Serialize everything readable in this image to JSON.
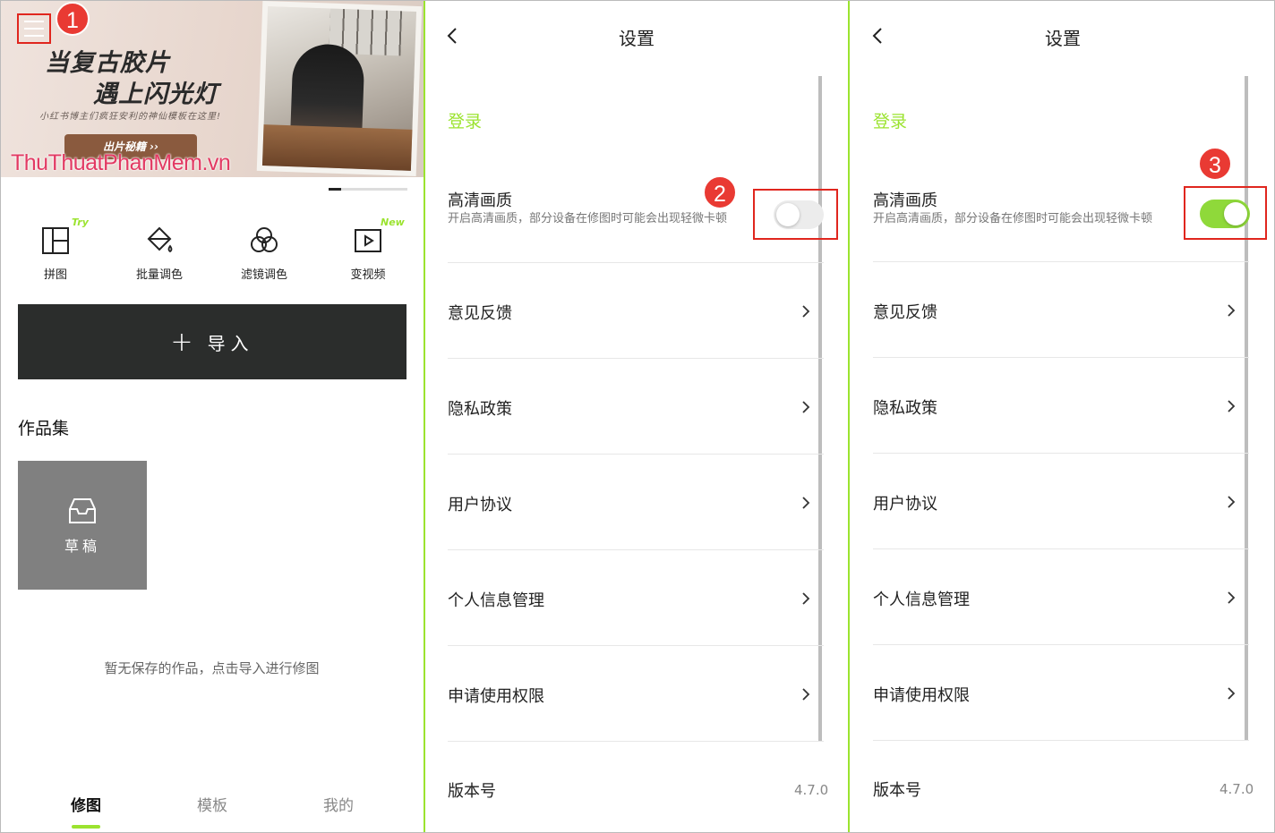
{
  "panel1": {
    "banner": {
      "title_line1": "当复古胶片",
      "title_line2": "遇上闪光灯",
      "subtitle": "小红书博主们疯狂安利的神仙模板在这里!",
      "button_label": "出片秘籍 ››",
      "watermark": "ThuThuatPhanMem.vn"
    },
    "step_badge": "1",
    "tools": [
      {
        "label": "拼图",
        "icon": "collage-icon",
        "tag": "Try"
      },
      {
        "label": "批量调色",
        "icon": "paint-bucket-icon",
        "tag": ""
      },
      {
        "label": "滤镜调色",
        "icon": "filter-circles-icon",
        "tag": ""
      },
      {
        "label": "变视频",
        "icon": "video-play-icon",
        "tag": "New"
      }
    ],
    "import_label": "导入",
    "collection_title": "作品集",
    "draft_label": "草稿",
    "empty_hint": "暂无保存的作品，点击导入进行修图",
    "bottom_nav": [
      {
        "label": "修图",
        "active": true
      },
      {
        "label": "模板",
        "active": false
      },
      {
        "label": "我的",
        "active": false
      }
    ]
  },
  "settings": {
    "title": "设置",
    "login": "登录",
    "hd_title": "高清画质",
    "hd_desc": "开启高清画质，部分设备在修图时可能会出现轻微卡顿",
    "rows": [
      "意见反馈",
      "隐私政策",
      "用户协议",
      "个人信息管理",
      "申请使用权限"
    ],
    "version_label": "版本号",
    "version_value": "4.7.0"
  },
  "panel2": {
    "toggle_on": false,
    "step_badge": "2"
  },
  "panel3": {
    "toggle_on": true,
    "step_badge": "3"
  },
  "colors": {
    "accent_green": "#9be32f",
    "toggle_on": "#8fd93a",
    "highlight_red": "#e0261e",
    "badge_red": "#e93a33",
    "import_bg": "#2b2d2c"
  }
}
